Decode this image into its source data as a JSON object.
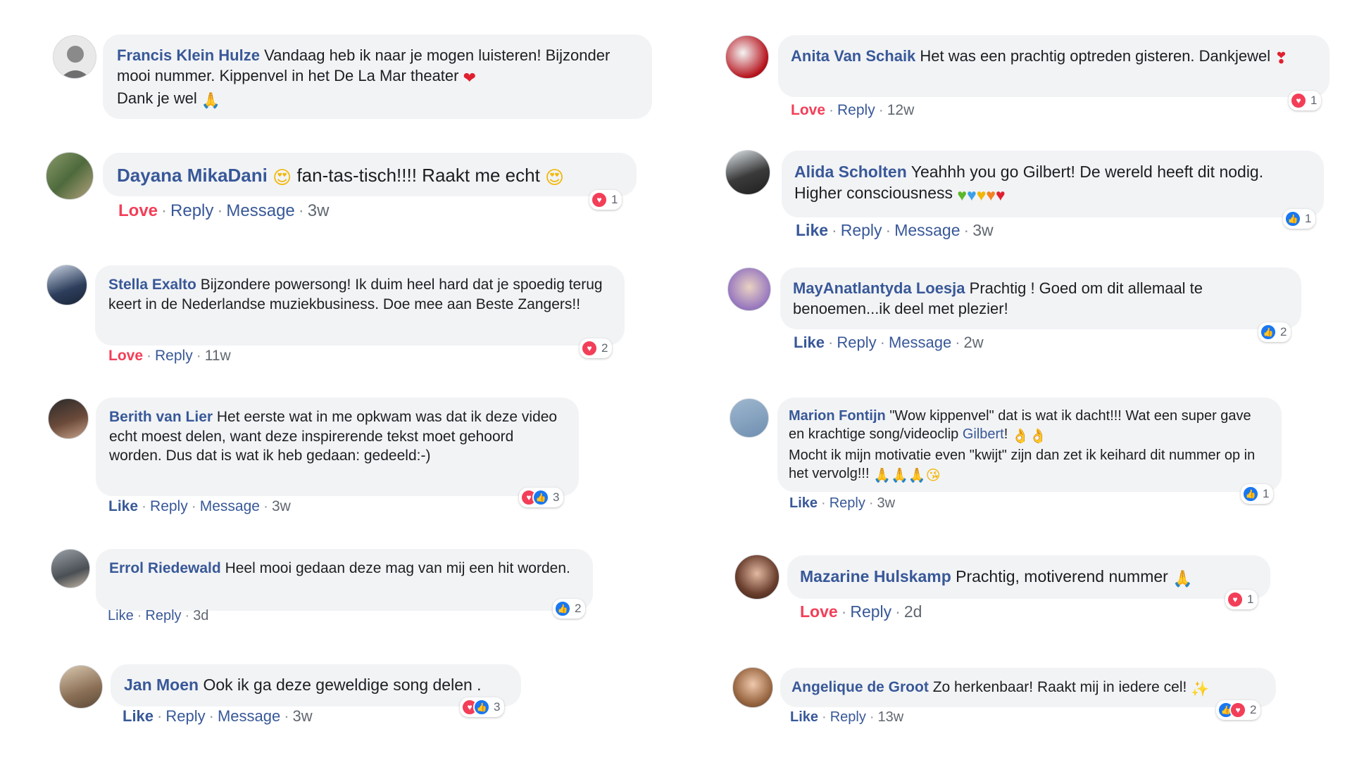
{
  "colors": {
    "author": "#385898",
    "love": "#f33e58",
    "like": "#1877f2",
    "bubble": "#f2f3f5"
  },
  "left": [
    {
      "author": "Francis Klein Hulze",
      "text": "Vandaag heb ik naar je mogen luisteren! Bijzonder mooi nummer. Kippenvel in het De La Mar theater",
      "text2": "Dank je wel",
      "emoji_after": "heart",
      "emoji_end": "pray"
    },
    {
      "author": "Dayana MikaDani",
      "text": "fan-tas-tisch!!!! Raakt me echt",
      "reaction_label": "Love",
      "reply": "Reply",
      "message": "Message",
      "time": "3w",
      "reaction_count": "1"
    },
    {
      "author": "Stella Exalto",
      "text": "Bijzondere powersong! Ik duim heel hard dat je spoedig terug keert in de Nederlandse muziekbusiness. Doe mee aan Beste Zangers!!",
      "reaction_label": "Love",
      "reply": "Reply",
      "time": "11w",
      "reaction_count": "2"
    },
    {
      "author": "Berith van Lier",
      "text": "Het eerste wat in me opkwam was dat ik deze video echt moest delen, want deze inspirerende tekst moet gehoord worden. Dus dat is wat ik heb gedaan: gedeeld:-)",
      "reaction_label": "Like",
      "reply": "Reply",
      "message": "Message",
      "time": "3w",
      "reaction_count": "3"
    },
    {
      "author": "Errol Riedewald",
      "text": "Heel mooi gedaan deze mag van mij een hit worden.",
      "reaction_label": "Like",
      "reply": "Reply",
      "time": "3d",
      "reaction_count": "2"
    },
    {
      "author": "Jan Moen",
      "text": "Ook ik ga deze geweldige song delen .",
      "reaction_label": "Like",
      "reply": "Reply",
      "message": "Message",
      "time": "3w",
      "reaction_count": "3"
    }
  ],
  "right": [
    {
      "author": "Anita Van Schaik",
      "text": "Het was een prachtig optreden gisteren. Dankjewel",
      "reaction_label": "Love",
      "reply": "Reply",
      "time": "12w",
      "reaction_count": "1"
    },
    {
      "author": "Alida Scholten",
      "text": "Yeahhh you go Gilbert! De wereld heeft dit nodig. Higher consciousness",
      "reaction_label": "Like",
      "reply": "Reply",
      "message": "Message",
      "time": "3w",
      "reaction_count": "1"
    },
    {
      "author": "MayAnatlantyda Loesja",
      "text": "Prachtig ! Goed om dit allemaal te benoemen...ik deel met plezier!",
      "reaction_label": "Like",
      "reply": "Reply",
      "message": "Message",
      "time": "2w",
      "reaction_count": "2"
    },
    {
      "author": "Marion Fontijn",
      "text": "\"Wow kippenvel\" dat is wat ik dacht!!! Wat een super gave en krachtige song/videoclip",
      "mention": "Gilbert",
      "text_after_mention": "!",
      "text2": "Mocht ik mijn motivatie even \"kwijt\" zijn dan zet ik keihard dit nummer op in het vervolg!!!",
      "reaction_label": "Like",
      "reply": "Reply",
      "time": "3w",
      "reaction_count": "1"
    },
    {
      "author": "Mazarine Hulskamp",
      "text": "Prachtig, motiverend nummer",
      "reaction_label": "Love",
      "reply": "Reply",
      "time": "2d",
      "reaction_count": "1"
    },
    {
      "author": "Angelique de Groot",
      "text": "Zo herkenbaar! Raakt mij in iedere cel!",
      "reaction_label": "Like",
      "reply": "Reply",
      "time": "13w",
      "reaction_count": "2"
    }
  ]
}
